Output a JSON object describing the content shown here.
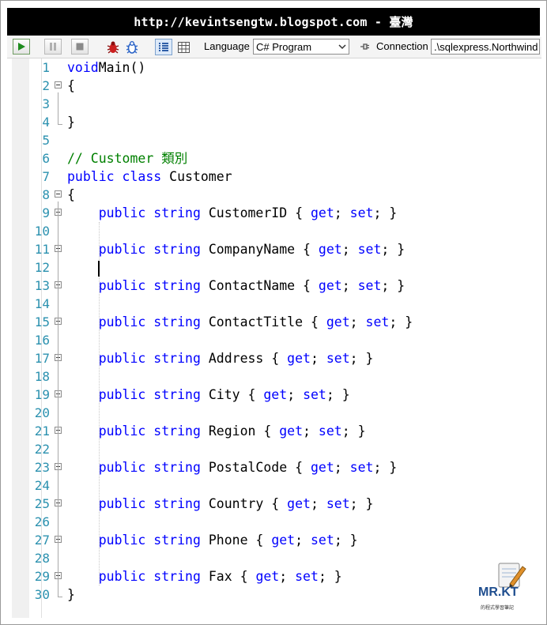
{
  "title": "http://kevintsengtw.blogspot.com - 臺灣",
  "toolbar": {
    "language_label": "Language",
    "language_value": "C# Program",
    "connection_label": "Connection",
    "connection_value": ".\\sqlexpress.Northwind",
    "icons": [
      "execute-icon",
      "pause-icon",
      "stop-icon",
      "red-bug-icon",
      "blue-bug-icon",
      "results-grid-icon",
      "data-grid-icon"
    ]
  },
  "colors": {
    "keyword": "#0000ff",
    "comment": "#008000",
    "line_number": "#2b91af",
    "title_bg": "#000000"
  },
  "editor": {
    "lines": [
      {
        "n": "1",
        "t": [
          [
            "kw",
            "void"
          ],
          [
            "",
            "Main()"
          ]
        ]
      },
      {
        "n": "2",
        "t": [
          [
            "",
            "{"
          ]
        ]
      },
      {
        "n": "3",
        "t": []
      },
      {
        "n": "4",
        "t": [
          [
            "",
            "}"
          ]
        ]
      },
      {
        "n": "5",
        "t": []
      },
      {
        "n": "6",
        "t": [
          [
            "cm",
            "// Customer 類別"
          ]
        ]
      },
      {
        "n": "7",
        "t": [
          [
            "kw",
            "public class "
          ],
          [
            "",
            "Customer"
          ]
        ]
      },
      {
        "n": "8",
        "t": [
          [
            "",
            "{"
          ]
        ]
      },
      {
        "n": "9",
        "t": [
          [
            "",
            "    "
          ],
          [
            "kw",
            "public string "
          ],
          [
            "",
            "CustomerID { "
          ],
          [
            "kw",
            "get"
          ],
          [
            "",
            "; "
          ],
          [
            "kw",
            "set"
          ],
          [
            "",
            "; }"
          ]
        ]
      },
      {
        "n": "10",
        "t": []
      },
      {
        "n": "11",
        "t": [
          [
            "",
            "    "
          ],
          [
            "kw",
            "public string "
          ],
          [
            "",
            "CompanyName { "
          ],
          [
            "kw",
            "get"
          ],
          [
            "",
            "; "
          ],
          [
            "kw",
            "set"
          ],
          [
            "",
            "; }"
          ]
        ]
      },
      {
        "n": "12",
        "t": []
      },
      {
        "n": "13",
        "t": [
          [
            "",
            "    "
          ],
          [
            "kw",
            "public string "
          ],
          [
            "",
            "ContactName { "
          ],
          [
            "kw",
            "get"
          ],
          [
            "",
            "; "
          ],
          [
            "kw",
            "set"
          ],
          [
            "",
            "; }"
          ]
        ]
      },
      {
        "n": "14",
        "t": []
      },
      {
        "n": "15",
        "t": [
          [
            "",
            "    "
          ],
          [
            "kw",
            "public string "
          ],
          [
            "",
            "ContactTitle { "
          ],
          [
            "kw",
            "get"
          ],
          [
            "",
            "; "
          ],
          [
            "kw",
            "set"
          ],
          [
            "",
            "; }"
          ]
        ]
      },
      {
        "n": "16",
        "t": []
      },
      {
        "n": "17",
        "t": [
          [
            "",
            "    "
          ],
          [
            "kw",
            "public string "
          ],
          [
            "",
            "Address { "
          ],
          [
            "kw",
            "get"
          ],
          [
            "",
            "; "
          ],
          [
            "kw",
            "set"
          ],
          [
            "",
            "; }"
          ]
        ]
      },
      {
        "n": "18",
        "t": []
      },
      {
        "n": "19",
        "t": [
          [
            "",
            "    "
          ],
          [
            "kw",
            "public string "
          ],
          [
            "",
            "City { "
          ],
          [
            "kw",
            "get"
          ],
          [
            "",
            "; "
          ],
          [
            "kw",
            "set"
          ],
          [
            "",
            "; }"
          ]
        ]
      },
      {
        "n": "20",
        "t": []
      },
      {
        "n": "21",
        "t": [
          [
            "",
            "    "
          ],
          [
            "kw",
            "public string "
          ],
          [
            "",
            "Region { "
          ],
          [
            "kw",
            "get"
          ],
          [
            "",
            "; "
          ],
          [
            "kw",
            "set"
          ],
          [
            "",
            "; }"
          ]
        ]
      },
      {
        "n": "22",
        "t": []
      },
      {
        "n": "23",
        "t": [
          [
            "",
            "    "
          ],
          [
            "kw",
            "public string "
          ],
          [
            "",
            "PostalCode { "
          ],
          [
            "kw",
            "get"
          ],
          [
            "",
            "; "
          ],
          [
            "kw",
            "set"
          ],
          [
            "",
            "; }"
          ]
        ]
      },
      {
        "n": "24",
        "t": []
      },
      {
        "n": "25",
        "t": [
          [
            "",
            "    "
          ],
          [
            "kw",
            "public string "
          ],
          [
            "",
            "Country { "
          ],
          [
            "kw",
            "get"
          ],
          [
            "",
            "; "
          ],
          [
            "kw",
            "set"
          ],
          [
            "",
            "; }"
          ]
        ]
      },
      {
        "n": "26",
        "t": []
      },
      {
        "n": "27",
        "t": [
          [
            "",
            "    "
          ],
          [
            "kw",
            "public string "
          ],
          [
            "",
            "Phone { "
          ],
          [
            "kw",
            "get"
          ],
          [
            "",
            "; "
          ],
          [
            "kw",
            "set"
          ],
          [
            "",
            "; }"
          ]
        ]
      },
      {
        "n": "28",
        "t": []
      },
      {
        "n": "29",
        "t": [
          [
            "",
            "    "
          ],
          [
            "kw",
            "public string "
          ],
          [
            "",
            "Fax { "
          ],
          [
            "kw",
            "get"
          ],
          [
            "",
            "; "
          ],
          [
            "kw",
            "set"
          ],
          [
            "",
            "; }"
          ]
        ]
      },
      {
        "n": "30",
        "t": [
          [
            "",
            "}"
          ]
        ]
      }
    ]
  },
  "logo": {
    "text": "MR.KT",
    "subtitle": "的程式學習筆記"
  }
}
